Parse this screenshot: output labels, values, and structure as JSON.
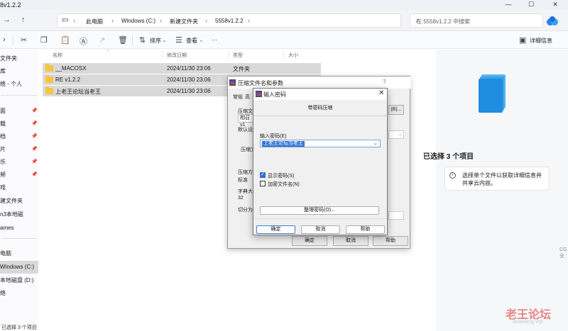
{
  "window": {
    "title": "8v1.2.2",
    "min": "—",
    "max": "☐",
    "close": "✕"
  },
  "address": {
    "breadcrumbs": [
      "此电脑",
      "Windows (C:)",
      "新建文件夹",
      "5558v1.2.2"
    ],
    "search_placeholder": "在 5558v1.2.2 中搜索"
  },
  "toolbar": {
    "sort_label": "排序",
    "view_label": "查看",
    "more_label": "···",
    "details_label": "详细信息"
  },
  "sidebar": {
    "items": [
      {
        "label": "文件夹",
        "pinned": false
      },
      {
        "label": "库",
        "pinned": false
      },
      {
        "label": "络 - 个人",
        "pinned": false
      },
      {
        "label": "面",
        "pinned": true
      },
      {
        "label": "载",
        "pinned": true
      },
      {
        "label": "档",
        "pinned": true
      },
      {
        "label": "片",
        "pinned": true
      },
      {
        "label": "乐",
        "pinned": true
      },
      {
        "label": "频",
        "pinned": true
      },
      {
        "label": "戏",
        "pinned": false
      },
      {
        "label": "建文件夹",
        "pinned": false
      },
      {
        "label": "n3本地磁",
        "pinned": false
      },
      {
        "label": "ames",
        "pinned": false
      },
      {
        "label": "电脑",
        "pinned": false
      },
      {
        "label": "Windows (C:)",
        "pinned": false,
        "selected": true
      },
      {
        "label": "本地磁盘 (D:)",
        "pinned": false
      },
      {
        "label": "络",
        "pinned": false
      }
    ]
  },
  "filelist": {
    "columns": [
      "名称",
      "修改日期",
      "类型",
      "大小"
    ],
    "rows": [
      {
        "name": "__MACOSX",
        "date": "2024/11/30 23:06",
        "type": "文件夹",
        "size": ""
      },
      {
        "name": "RE v1.2.2",
        "date": "2024/11/30 23:06",
        "type": "文件夹",
        "size": ""
      },
      {
        "name": "上老王论坛当老王",
        "date": "2024/11/30 23:06",
        "type": "文件夹",
        "size": ""
      }
    ]
  },
  "details": {
    "title": "已选择 3 个项目",
    "hint": "选择单个文件以获取详细信息并共享云内容。"
  },
  "status": {
    "text": "已选择 3 个项目"
  },
  "back_dialog": {
    "title": "压缩文件名和参数",
    "help_glyph": "?",
    "tab_general": "常规",
    "tab_advanced": "高",
    "label_archive": "压缩文",
    "archive_value": "相召v1",
    "browse_label": "(B)...",
    "label_default": "默认设",
    "label_format": "压缩文",
    "label_method": "压缩方",
    "method_value": "标准",
    "label_dict": "字典大",
    "dict_value": "32",
    "label_split": "切分为",
    "ok": "确定",
    "cancel": "取消",
    "help": "帮助"
  },
  "front_dialog": {
    "title": "输入密码",
    "close_glyph": "✕",
    "subtitle": "带密码压缩",
    "password_label": "输入密码(E)",
    "password_value": "上老王论坛当老王",
    "show_password_label": "显示密码(S)",
    "show_password_checked": true,
    "encrypt_names_label": "加密文件名(N)",
    "encrypt_names_checked": false,
    "organize_label": "整理密码(O)...",
    "ok": "确定",
    "cancel": "取消",
    "help": "帮助"
  },
  "watermark": {
    "text": "老王论坛",
    "url": "laowang.vip"
  },
  "edge_text": "CG全"
}
